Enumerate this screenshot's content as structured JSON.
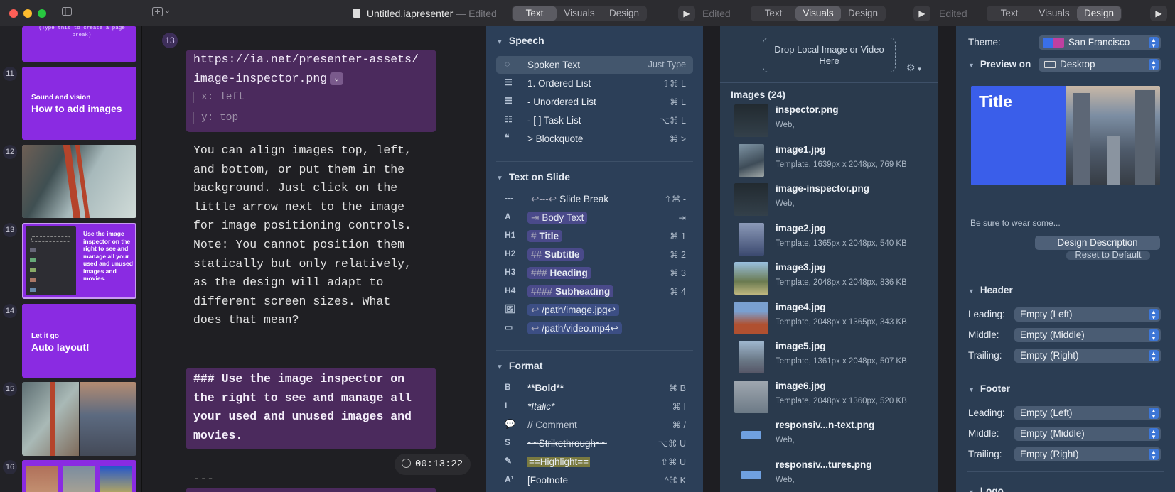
{
  "window": {
    "title": "Untitled.iapresenter",
    "edited": "Edited",
    "separator": "—"
  },
  "segments": {
    "text": "Text",
    "visuals": "Visuals",
    "design": "Design"
  },
  "sidebar": {
    "top_text": "(Type this to create a page break)",
    "slides": [
      {
        "num": "11",
        "small": "Sound and vision",
        "big": "How to add images"
      },
      {
        "num": "12"
      },
      {
        "num": "13",
        "text": "Use the image inspector on the right to see and manage all your used and unused images and movies."
      },
      {
        "num": "14",
        "small": "Let it go",
        "big": "Auto layout!"
      },
      {
        "num": "15"
      },
      {
        "num": "16"
      }
    ]
  },
  "editor": {
    "slide_num": "13",
    "url_line1": "https://ia.net/presenter-assets/",
    "url_line2": "image-inspector.png",
    "chevron": "⌄",
    "x": "x: left",
    "y": "y: top",
    "para": [
      "You can align images top, left,",
      "and bottom, or put  them in the",
      "background. Just click on the",
      "little arrow next to the image",
      "for image positioning controls.",
      "Note: You cannot position them",
      "statically but only relatively,",
      "as the design will adapt to",
      "different screen sizes. What",
      "does that mean?"
    ],
    "heading": [
      "### Use the image inspector on",
      "the right to see and manage all",
      "your used and unused images and",
      "movies."
    ],
    "separator": "---",
    "timer": "00:13:22"
  },
  "text_panel": {
    "speech_title": "Speech",
    "speech_rows": [
      {
        "label": "Spoken Text",
        "shortcut": "Just Type",
        "icon": "speech-bubble-icon"
      },
      {
        "label": "1. Ordered List",
        "shortcut": "⇧⌘ L",
        "icon": "ordered-list-icon"
      },
      {
        "label": "- Unordered List",
        "shortcut": "⌘ L",
        "icon": "unordered-list-icon"
      },
      {
        "label": "- [ ] Task List",
        "shortcut": "⌥⌘ L",
        "icon": "task-list-icon"
      },
      {
        "label": "> Blockquote",
        "shortcut": "⌘ >",
        "icon": "blockquote-icon"
      }
    ],
    "slide_title": "Text on Slide",
    "slide_rows": [
      {
        "ic": "---",
        "prefix": "↩---↩",
        "label": "Slide Break",
        "shortcut": "⇧⌘ -"
      },
      {
        "ic": "A",
        "prefix": "⇥",
        "label": "Body Text",
        "shortcut": "⇥"
      },
      {
        "ic": "H1",
        "prefix": "#",
        "label": "Title",
        "shortcut": "⌘ 1"
      },
      {
        "ic": "H2",
        "prefix": "##",
        "label": "Subtitle",
        "shortcut": "⌘ 2"
      },
      {
        "ic": "H3",
        "prefix": "###",
        "label": "Heading",
        "shortcut": "⌘ 3"
      },
      {
        "ic": "H4",
        "prefix": "####",
        "label": "Subheading",
        "shortcut": "⌘ 4"
      },
      {
        "ic": "🖼",
        "prefix": "↩",
        "label": "/path/image.jpg↩",
        "shortcut": ""
      },
      {
        "ic": "▭",
        "prefix": "↩",
        "label": "/path/video.mp4↩",
        "shortcut": ""
      }
    ],
    "format_title": "Format",
    "format_rows": [
      {
        "ic": "B",
        "label": "**Bold**",
        "shortcut": "⌘ B"
      },
      {
        "ic": "I",
        "label": "*Italic*",
        "shortcut": "⌘ I"
      },
      {
        "ic": "💬",
        "label": "// Comment",
        "shortcut": "⌘ /"
      },
      {
        "ic": "S",
        "label": "~~Strikethrough~~",
        "shortcut": "⌥⌘ U"
      },
      {
        "ic": "✎",
        "label": "==Highlight==",
        "shortcut": "⇧⌘ U"
      },
      {
        "ic": "A¹",
        "label": "[Footnote",
        "shortcut": "^⌘ K"
      }
    ]
  },
  "visuals_panel": {
    "drop_line1": "Drop Local Image or Video",
    "drop_line2": "Here",
    "images_title": "Images (24)",
    "images": [
      {
        "name": "inspector.png",
        "meta": "Web,"
      },
      {
        "name": "image1.jpg",
        "meta": "Template, 1639px x 2048px,  769 KB"
      },
      {
        "name": "image-inspector.png",
        "meta": "Web,"
      },
      {
        "name": "image2.jpg",
        "meta": "Template, 1365px x 2048px,  540 KB"
      },
      {
        "name": "image3.jpg",
        "meta": "Template, 2048px x 2048px,  836 KB"
      },
      {
        "name": "image4.jpg",
        "meta": "Template, 2048px x 1365px,  343 KB"
      },
      {
        "name": "image5.jpg",
        "meta": "Template, 1361px x 2048px,  507 KB"
      },
      {
        "name": "image6.jpg",
        "meta": "Template, 2048px x 1360px,  520 KB"
      },
      {
        "name": "responsiv...n-text.png",
        "meta": "Web,"
      },
      {
        "name": "responsiv...tures.png",
        "meta": "Web,"
      }
    ]
  },
  "design_panel": {
    "theme_label": "Theme:",
    "theme_value": "San Francisco",
    "preview_label": "Preview on",
    "preview_value": "Desktop",
    "preview_title": "Title",
    "hint": "Be sure to wear some...",
    "design_desc": "Design Description",
    "reset": "Reset to Default",
    "header_title": "Header",
    "footer_title": "Footer",
    "logo_title": "Logo",
    "leading": "Leading:",
    "middle": "Middle:",
    "trailing": "Trailing:",
    "empty_left": "Empty (Left)",
    "empty_middle": "Empty (Middle)",
    "empty_right": "Empty (Right)"
  }
}
